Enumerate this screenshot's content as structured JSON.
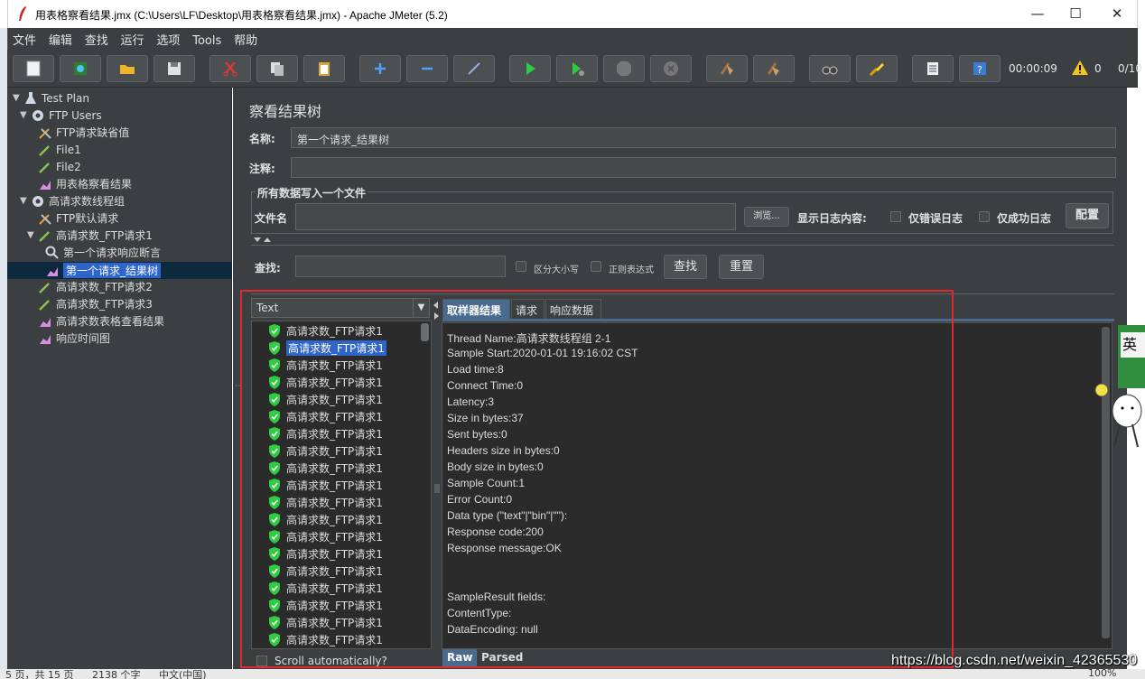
{
  "window": {
    "title": "用表格察看结果.jmx (C:\\Users\\LF\\Desktop\\用表格察看结果.jmx) - Apache JMeter (5.2)",
    "minimize": "—",
    "maximize": "☐",
    "close": "✕"
  },
  "menu": [
    "文件",
    "编辑",
    "查找",
    "运行",
    "选项",
    "Tools",
    "帮助"
  ],
  "toolbar": {
    "timer": "00:00:09",
    "warnings": "0",
    "threads": "0/10"
  },
  "tree": [
    {
      "label": "Test Plan",
      "icon": "test-plan-icon"
    },
    {
      "label": "FTP Users",
      "icon": "gear-icon"
    },
    {
      "label": "FTP请求缺省值",
      "icon": "wrench-icon"
    },
    {
      "label": "File1",
      "icon": "pipette-icon"
    },
    {
      "label": "File2",
      "icon": "pipette-icon"
    },
    {
      "label": "用表格察看结果",
      "icon": "chart-icon"
    },
    {
      "label": "高请求数线程组",
      "icon": "gear-icon"
    },
    {
      "label": "FTP默认请求",
      "icon": "wrench-icon"
    },
    {
      "label": "高请求数_FTP请求1",
      "icon": "pipette-icon"
    },
    {
      "label": "第一个请求响应断言",
      "icon": "magnifier-icon"
    },
    {
      "label": "第一个请求_结果树",
      "icon": "chart-icon"
    },
    {
      "label": "高请求数_FTP请求2",
      "icon": "pipette-icon"
    },
    {
      "label": "高请求数_FTP请求3",
      "icon": "pipette-icon"
    },
    {
      "label": "高请求数表格查看结果",
      "icon": "chart-icon"
    },
    {
      "label": "响应时间图",
      "icon": "chart-icon"
    }
  ],
  "panel": {
    "title": "察看结果树",
    "name_label": "名称:",
    "name_value": "第一个请求_结果树",
    "comment_label": "注释:",
    "comment_value": "",
    "file_group_legend": "所有数据写入一个文件",
    "filename_label": "文件名",
    "filename_value": "",
    "browse_button": "浏览...",
    "log_content_label": "显示日志内容:",
    "errors_only": "仅错误日志",
    "success_only": "仅成功日志",
    "configure_button": "配置",
    "search_label": "查找:",
    "search_value": "",
    "case_sensitive": "区分大小写",
    "regex": "正则表达式",
    "search_button": "查找",
    "reset_button": "重置"
  },
  "results": {
    "renderer": "Text",
    "items": [
      "高请求数_FTP请求1",
      "高请求数_FTP请求1",
      "高请求数_FTP请求1",
      "高请求数_FTP请求1",
      "高请求数_FTP请求1",
      "高请求数_FTP请求1",
      "高请求数_FTP请求1",
      "高请求数_FTP请求1",
      "高请求数_FTP请求1",
      "高请求数_FTP请求1",
      "高请求数_FTP请求1",
      "高请求数_FTP请求1",
      "高请求数_FTP请求1",
      "高请求数_FTP请求1",
      "高请求数_FTP请求1",
      "高请求数_FTP请求1",
      "高请求数_FTP请求1",
      "高请求数_FTP请求1",
      "高请求数_FTP请求1"
    ],
    "selected_index": 1,
    "scroll_auto": "Scroll automatically?",
    "tabs": [
      "取样器结果",
      "请求",
      "响应数据"
    ],
    "detail_lines": [
      "Thread Name:高请求数线程组 2-1",
      "Sample Start:2020-01-01 19:16:02 CST",
      "Load time:8",
      "Connect Time:0",
      "Latency:3",
      "Size in bytes:37",
      "Sent bytes:0",
      "Headers size in bytes:0",
      "Body size in bytes:0",
      "Sample Count:1",
      "Error Count:0",
      "Data type (\"text\"|\"bin\"|\"\"):",
      "Response code:200",
      "Response message:OK",
      "",
      "",
      "SampleResult fields:",
      "ContentType:",
      "DataEncoding: null"
    ],
    "bottom_tabs": [
      "Raw",
      "Parsed"
    ]
  },
  "watermark": "https://blog.csdn.net/weixin_42365530",
  "statusbar": {
    "pages": "5 页，共 15 页",
    "words": "2138 个字",
    "lang": "中文(中国)",
    "zoom": "100%"
  },
  "colors": {
    "background": "#3c3f41",
    "selection": "#2f65ca",
    "highlight_box": "#e1282d",
    "tab_active": "#4a6b8e"
  }
}
